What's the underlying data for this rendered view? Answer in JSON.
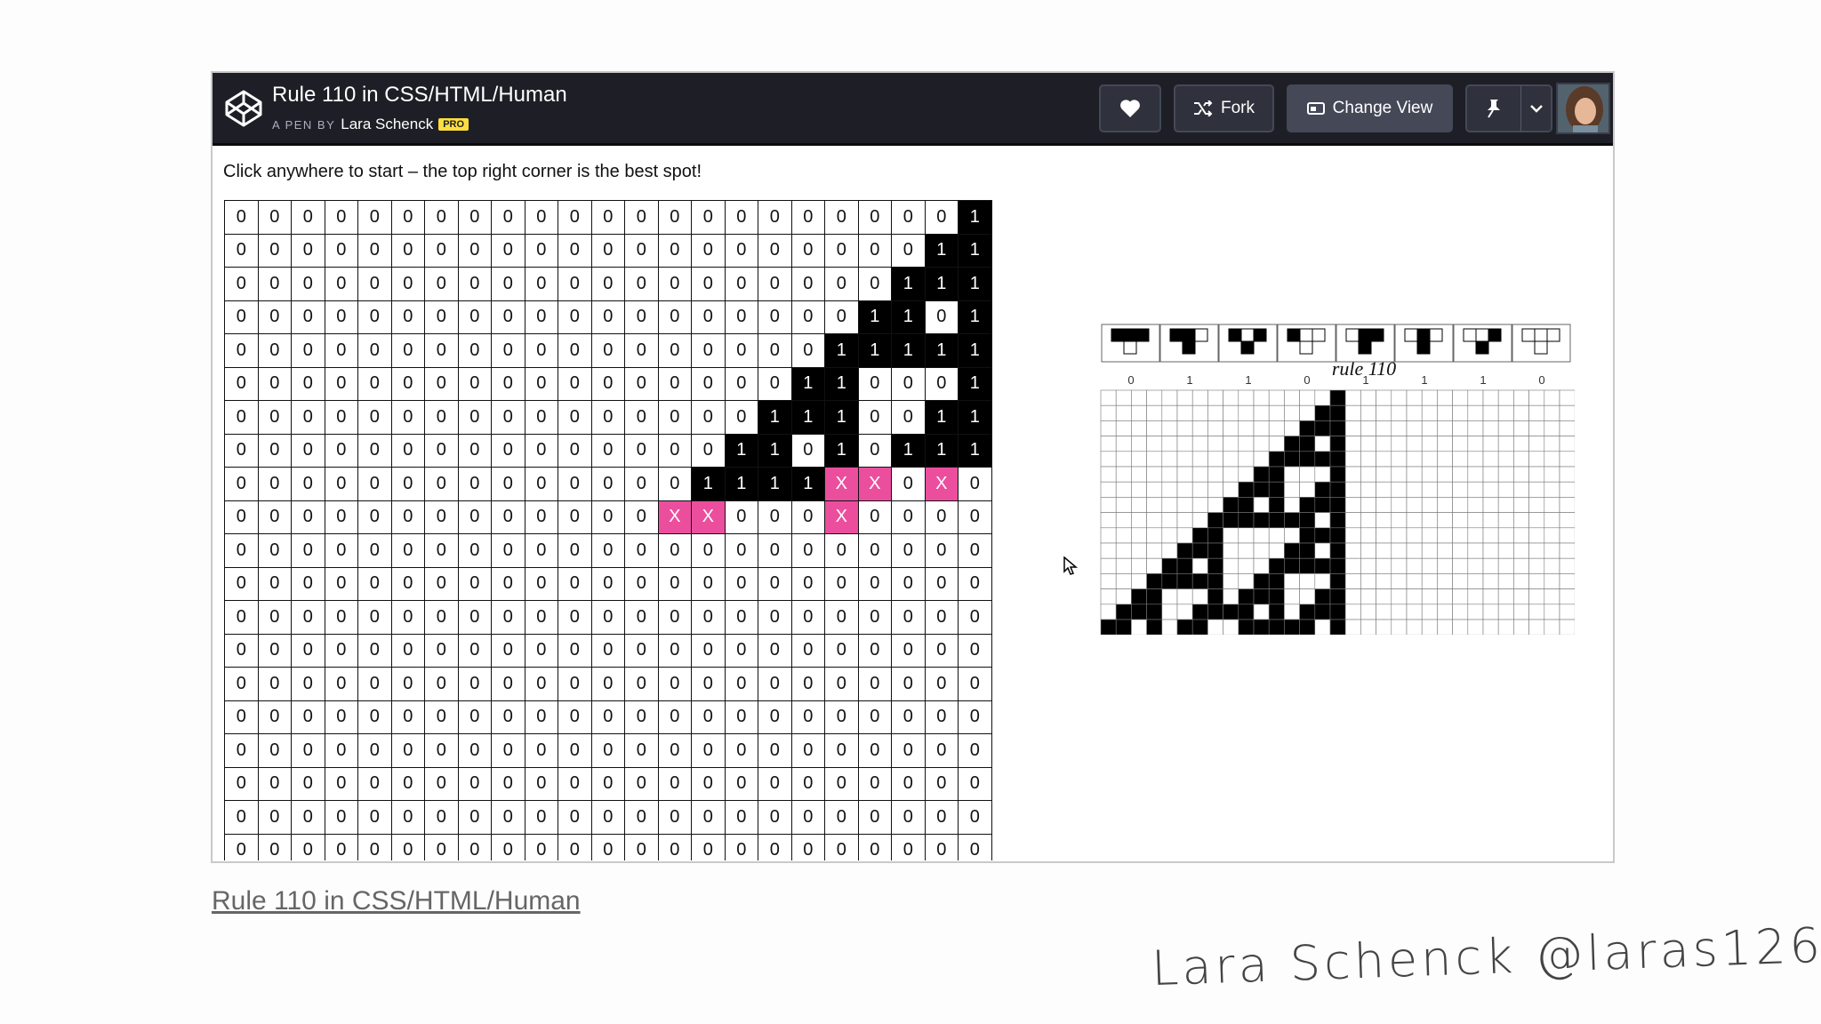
{
  "header": {
    "title": "Rule 110 in CSS/HTML/Human",
    "byline_prefix": "A PEN BY",
    "author": "Lara Schenck",
    "badge": "PRO",
    "buttons": {
      "heart_icon": "heart-icon",
      "fork": "Fork",
      "change_view": "Change View",
      "pin_icon": "pin-icon",
      "dropdown_icon": "chevron-down-icon"
    }
  },
  "instruction": "Click anywhere to start – the top right corner is the best spot!",
  "grid": {
    "rows": [
      "00000000000000000000001",
      "00000000000000000000011",
      "00000000000000000000111",
      "00000000000000000001101",
      "00000000000000000011111",
      "00000000000000000110001",
      "00000000000000001110011",
      "00000000000000011010111",
      "000000000000001111XX0X",
      "0000000000000XX000X0000",
      "00000000000000000000000",
      "00000000000000000000000",
      "00000000000000000000000",
      "00000000000000000000000",
      "00000000000000000000000",
      "00000000000000000000000",
      "00000000000000000000000",
      "00000000000000000000000",
      "00000000000000000000000",
      "00000000000000000000000"
    ],
    "highlight_color": "#ec4e9e"
  },
  "rule_diagram": {
    "title": "rule 110",
    "patterns": [
      "111",
      "110",
      "101",
      "100",
      "011",
      "010",
      "001",
      "000"
    ],
    "outputs": [
      "0",
      "1",
      "1",
      "0",
      "1",
      "1",
      "1",
      "0"
    ]
  },
  "automaton": {
    "rows": 16,
    "cols": 31,
    "rule": 110
  },
  "link_text": "Rule 110 in CSS/HTML/Human",
  "signature": "Lara Schenck  @laras126"
}
